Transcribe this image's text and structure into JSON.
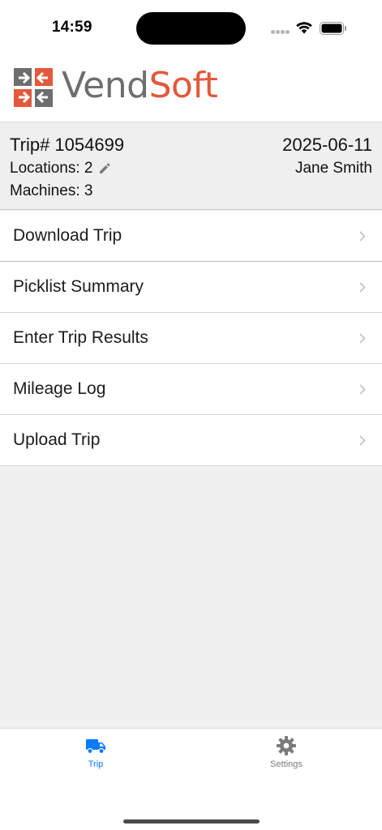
{
  "status_bar": {
    "time": "14:59"
  },
  "header": {
    "logo_text_vend": "Vend",
    "logo_text_soft": "Soft",
    "brand_orange": "#e4583c",
    "brand_gray": "#6d6e70"
  },
  "trip": {
    "number_label": "Trip# 1054699",
    "date": "2025-06-11",
    "locations_label": "Locations: 2",
    "driver": "Jane Smith",
    "machines_label": "Machines: 3"
  },
  "menu": {
    "items": [
      {
        "label": "Download Trip",
        "icon": "chevron-right-icon"
      },
      {
        "label": "Picklist Summary",
        "icon": "chevron-right-icon"
      },
      {
        "label": "Enter Trip Results",
        "icon": "chevron-right-icon"
      },
      {
        "label": "Mileage Log",
        "icon": "chevron-right-icon"
      },
      {
        "label": "Upload Trip",
        "icon": "chevron-right-icon"
      }
    ]
  },
  "tab_bar": {
    "tabs": [
      {
        "label": "Trip",
        "icon": "truck-icon",
        "active": true
      },
      {
        "label": "Settings",
        "icon": "gear-icon",
        "active": false
      }
    ],
    "active_color": "#0a7aff",
    "inactive_color": "#7b7b7b"
  }
}
